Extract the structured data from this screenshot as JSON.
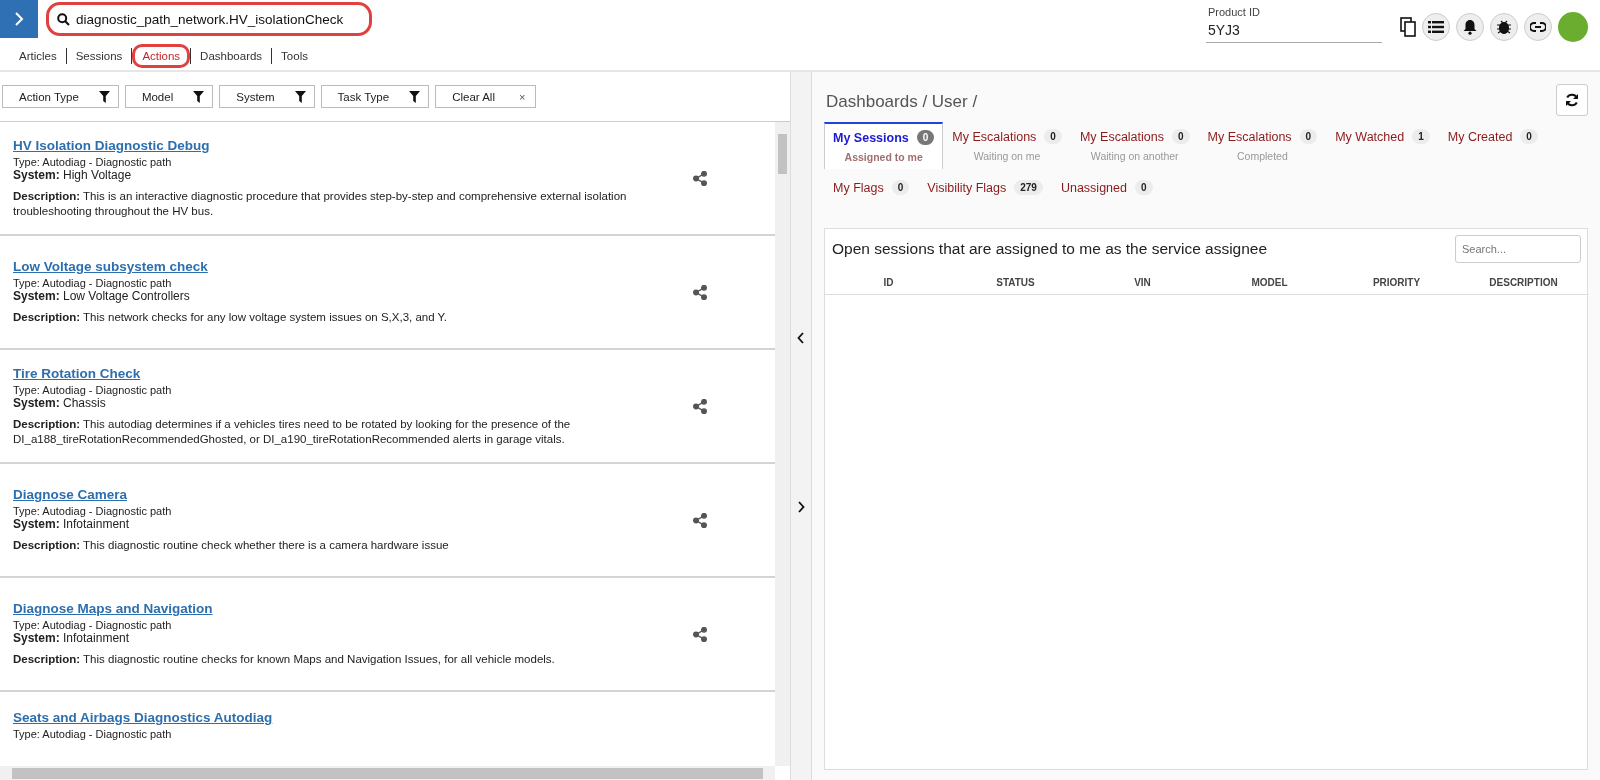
{
  "search": {
    "value": "diagnostic_path_network.HV_isolationCheck",
    "highlighted": true
  },
  "nav_tabs": [
    {
      "label": "Articles",
      "selected": false,
      "highlighted": false
    },
    {
      "label": "Sessions",
      "selected": false,
      "highlighted": false
    },
    {
      "label": "Actions",
      "selected": true,
      "highlighted": true
    },
    {
      "label": "Dashboards",
      "selected": false,
      "highlighted": false
    },
    {
      "label": "Tools",
      "selected": false,
      "highlighted": false
    }
  ],
  "product_id": {
    "label": "Product ID",
    "value": "5YJ3"
  },
  "filters": [
    {
      "label": "Action Type",
      "kind": "filter"
    },
    {
      "label": "Model",
      "kind": "filter"
    },
    {
      "label": "System",
      "kind": "filter"
    },
    {
      "label": "Task Type",
      "kind": "filter"
    },
    {
      "label": "Clear All",
      "kind": "clear",
      "symbol": "×"
    }
  ],
  "actions": [
    {
      "title": "HV Isolation Diagnostic Debug",
      "type": "Type: Autodiag - Diagnostic path",
      "system": "**System:** High Voltage",
      "description": "**Description:** This is an interactive diagnostic procedure that provides step-by-step and comprehensive external isolation troubleshooting throughout the HV bus."
    },
    {
      "title": "Low Voltage subsystem check",
      "type": "Type: Autodiag - Diagnostic path",
      "system": "**System:** Low Voltage Controllers",
      "description": "**Description:** This network checks for any low voltage system issues on S,X,3, and Y."
    },
    {
      "title": "Tire Rotation Check",
      "type": "Type: Autodiag - Diagnostic path",
      "system": "**System:** Chassis",
      "description": "**Description:** This autodiag determines if a vehicles tires need to be rotated by looking for the presence of the DI_a188_tireRotationRecommendedGhosted, or DI_a190_tireRotationRecommended alerts in garage vitals."
    },
    {
      "title": "Diagnose Camera",
      "type": "Type: Autodiag - Diagnostic path",
      "system": "**System:** Infotainment",
      "description": "**Description:** This diagnostic routine check whether there is a camera hardware issue"
    },
    {
      "title": "Diagnose Maps and Navigation",
      "type": "Type: Autodiag - Diagnostic path",
      "system": "**System:** Infotainment",
      "description": "**Description:** This diagnostic routine checks for known Maps and Navigation Issues, for all vehicle models."
    },
    {
      "title": "Seats and Airbags Diagnostics Autodiag",
      "type": "Type: Autodiag - Diagnostic path"
    }
  ],
  "dashboard": {
    "breadcrumb": "Dashboards / User /",
    "tabs": [
      {
        "label": "My Sessions",
        "count": "0",
        "sublabel": "Assigned to me",
        "selected": true
      },
      {
        "label": "My Escalations",
        "count": "0",
        "sublabel": "Waiting on me",
        "selected": false
      },
      {
        "label": "My Escalations",
        "count": "0",
        "sublabel": "Waiting on another",
        "selected": false
      },
      {
        "label": "My Escalations",
        "count": "0",
        "sublabel": "Completed",
        "selected": false
      },
      {
        "label": "My Watched",
        "count": "1",
        "selected": false
      },
      {
        "label": "My Created",
        "count": "0",
        "selected": false
      },
      {
        "label": "My Flags",
        "count": "0",
        "selected": false
      },
      {
        "label": "Visibility Flags",
        "count": "279",
        "selected": false
      },
      {
        "label": "Unassigned",
        "count": "0",
        "selected": false
      }
    ],
    "table": {
      "title": "Open sessions that are assigned to me as the service assignee",
      "search_placeholder": "Search...",
      "columns": [
        "ID",
        "STATUS",
        "VIN",
        "MODEL",
        "PRIORITY",
        "DESCRIPTION"
      ]
    }
  }
}
